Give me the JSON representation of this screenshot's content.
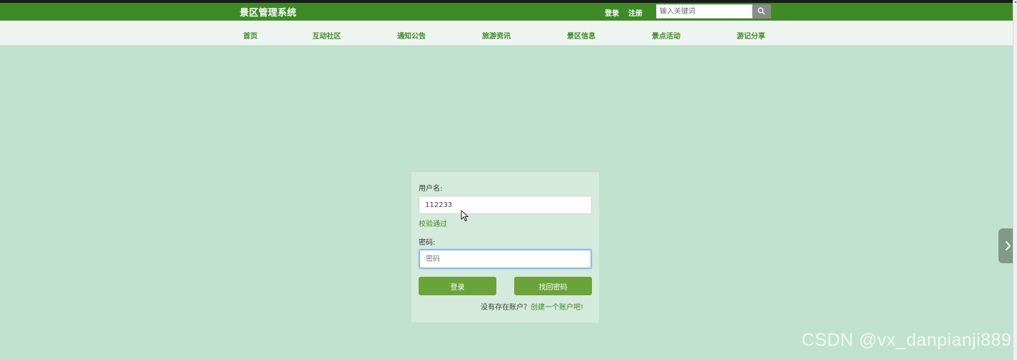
{
  "header": {
    "brand": "景区管理系统",
    "login_label": "登录",
    "register_label": "注册",
    "search_placeholder": "输入关键词"
  },
  "nav": {
    "items": [
      "首页",
      "互动社区",
      "通知公告",
      "旅游资讯",
      "景区信息",
      "景点活动",
      "游记分享"
    ]
  },
  "login_form": {
    "username_label": "用户名:",
    "username_value": "112233",
    "validation_message": "校验通过",
    "password_label": "密码:",
    "password_placeholder": "密码",
    "login_button": "登录",
    "recover_button": "找回密码",
    "no_account_text": "没有存在账户？",
    "create_account_link": "创建一个账户吧!"
  },
  "watermark": "CSDN @vx_danpianji889",
  "colors": {
    "header_green": "#3f8a27",
    "page_bg": "#c1e1cf",
    "button_green": "#69a33a"
  },
  "icons": {
    "search": "search-icon",
    "side_arrow": "chevron-right-icon",
    "cursor": "mouse-pointer-icon"
  }
}
